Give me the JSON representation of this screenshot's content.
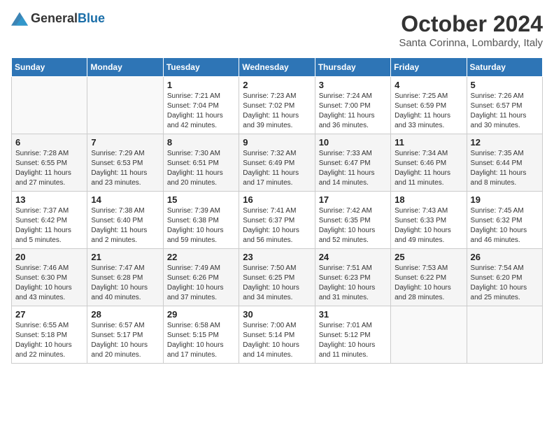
{
  "logo": {
    "general": "General",
    "blue": "Blue"
  },
  "title": "October 2024",
  "subtitle": "Santa Corinna, Lombardy, Italy",
  "days_header": [
    "Sunday",
    "Monday",
    "Tuesday",
    "Wednesday",
    "Thursday",
    "Friday",
    "Saturday"
  ],
  "weeks": [
    [
      {
        "day": "",
        "info": ""
      },
      {
        "day": "",
        "info": ""
      },
      {
        "day": "1",
        "info": "Sunrise: 7:21 AM\nSunset: 7:04 PM\nDaylight: 11 hours and 42 minutes."
      },
      {
        "day": "2",
        "info": "Sunrise: 7:23 AM\nSunset: 7:02 PM\nDaylight: 11 hours and 39 minutes."
      },
      {
        "day": "3",
        "info": "Sunrise: 7:24 AM\nSunset: 7:00 PM\nDaylight: 11 hours and 36 minutes."
      },
      {
        "day": "4",
        "info": "Sunrise: 7:25 AM\nSunset: 6:59 PM\nDaylight: 11 hours and 33 minutes."
      },
      {
        "day": "5",
        "info": "Sunrise: 7:26 AM\nSunset: 6:57 PM\nDaylight: 11 hours and 30 minutes."
      }
    ],
    [
      {
        "day": "6",
        "info": "Sunrise: 7:28 AM\nSunset: 6:55 PM\nDaylight: 11 hours and 27 minutes."
      },
      {
        "day": "7",
        "info": "Sunrise: 7:29 AM\nSunset: 6:53 PM\nDaylight: 11 hours and 23 minutes."
      },
      {
        "day": "8",
        "info": "Sunrise: 7:30 AM\nSunset: 6:51 PM\nDaylight: 11 hours and 20 minutes."
      },
      {
        "day": "9",
        "info": "Sunrise: 7:32 AM\nSunset: 6:49 PM\nDaylight: 11 hours and 17 minutes."
      },
      {
        "day": "10",
        "info": "Sunrise: 7:33 AM\nSunset: 6:47 PM\nDaylight: 11 hours and 14 minutes."
      },
      {
        "day": "11",
        "info": "Sunrise: 7:34 AM\nSunset: 6:46 PM\nDaylight: 11 hours and 11 minutes."
      },
      {
        "day": "12",
        "info": "Sunrise: 7:35 AM\nSunset: 6:44 PM\nDaylight: 11 hours and 8 minutes."
      }
    ],
    [
      {
        "day": "13",
        "info": "Sunrise: 7:37 AM\nSunset: 6:42 PM\nDaylight: 11 hours and 5 minutes."
      },
      {
        "day": "14",
        "info": "Sunrise: 7:38 AM\nSunset: 6:40 PM\nDaylight: 11 hours and 2 minutes."
      },
      {
        "day": "15",
        "info": "Sunrise: 7:39 AM\nSunset: 6:38 PM\nDaylight: 10 hours and 59 minutes."
      },
      {
        "day": "16",
        "info": "Sunrise: 7:41 AM\nSunset: 6:37 PM\nDaylight: 10 hours and 56 minutes."
      },
      {
        "day": "17",
        "info": "Sunrise: 7:42 AM\nSunset: 6:35 PM\nDaylight: 10 hours and 52 minutes."
      },
      {
        "day": "18",
        "info": "Sunrise: 7:43 AM\nSunset: 6:33 PM\nDaylight: 10 hours and 49 minutes."
      },
      {
        "day": "19",
        "info": "Sunrise: 7:45 AM\nSunset: 6:32 PM\nDaylight: 10 hours and 46 minutes."
      }
    ],
    [
      {
        "day": "20",
        "info": "Sunrise: 7:46 AM\nSunset: 6:30 PM\nDaylight: 10 hours and 43 minutes."
      },
      {
        "day": "21",
        "info": "Sunrise: 7:47 AM\nSunset: 6:28 PM\nDaylight: 10 hours and 40 minutes."
      },
      {
        "day": "22",
        "info": "Sunrise: 7:49 AM\nSunset: 6:26 PM\nDaylight: 10 hours and 37 minutes."
      },
      {
        "day": "23",
        "info": "Sunrise: 7:50 AM\nSunset: 6:25 PM\nDaylight: 10 hours and 34 minutes."
      },
      {
        "day": "24",
        "info": "Sunrise: 7:51 AM\nSunset: 6:23 PM\nDaylight: 10 hours and 31 minutes."
      },
      {
        "day": "25",
        "info": "Sunrise: 7:53 AM\nSunset: 6:22 PM\nDaylight: 10 hours and 28 minutes."
      },
      {
        "day": "26",
        "info": "Sunrise: 7:54 AM\nSunset: 6:20 PM\nDaylight: 10 hours and 25 minutes."
      }
    ],
    [
      {
        "day": "27",
        "info": "Sunrise: 6:55 AM\nSunset: 5:18 PM\nDaylight: 10 hours and 22 minutes."
      },
      {
        "day": "28",
        "info": "Sunrise: 6:57 AM\nSunset: 5:17 PM\nDaylight: 10 hours and 20 minutes."
      },
      {
        "day": "29",
        "info": "Sunrise: 6:58 AM\nSunset: 5:15 PM\nDaylight: 10 hours and 17 minutes."
      },
      {
        "day": "30",
        "info": "Sunrise: 7:00 AM\nSunset: 5:14 PM\nDaylight: 10 hours and 14 minutes."
      },
      {
        "day": "31",
        "info": "Sunrise: 7:01 AM\nSunset: 5:12 PM\nDaylight: 10 hours and 11 minutes."
      },
      {
        "day": "",
        "info": ""
      },
      {
        "day": "",
        "info": ""
      }
    ]
  ]
}
